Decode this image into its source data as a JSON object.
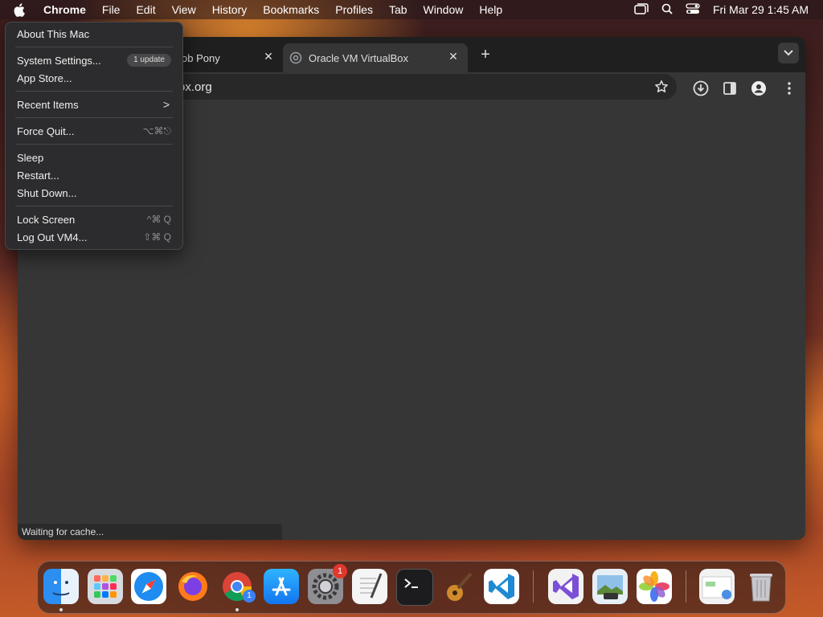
{
  "menubar": {
    "items": [
      "Chrome",
      "File",
      "Edit",
      "View",
      "History",
      "Bookmarks",
      "Profiles",
      "Tab",
      "Window",
      "Help"
    ],
    "clock": "Fri Mar 29  1:45 AM",
    "icons": [
      "apple-icon",
      "window-icon",
      "search-icon",
      "control-center-icon"
    ]
  },
  "apple_menu": {
    "items": [
      {
        "label": "About This Mac"
      },
      {
        "label": "System Settings...",
        "badge": "1 update"
      },
      {
        "label": "App Store..."
      },
      {
        "label": "Recent Items",
        "submenu": ">"
      },
      {
        "label": "Force Quit...",
        "shortcut": "⌥⌘⎋"
      },
      {
        "label": "Sleep"
      },
      {
        "label": "Restart..."
      },
      {
        "label": "Shut Down..."
      },
      {
        "label": "Lock Screen",
        "shortcut": "^⌘ Q"
      },
      {
        "label": "Log Out VM4...",
        "shortcut": "⇧⌘ Q"
      }
    ]
  },
  "browser": {
    "tabs": [
      {
        "title": "Bob Pony",
        "visible_text": "ob Pony"
      },
      {
        "title": "Oracle VM VirtualBox",
        "active": true
      }
    ],
    "tab_close": "✕",
    "new_tab": "+",
    "address_visible": "ox.org",
    "status": "Waiting for cache..."
  },
  "dock": {
    "apps": [
      "Finder",
      "Launchpad",
      "Safari",
      "Firefox",
      "Chrome",
      "App Store",
      "System Settings",
      "TextEdit",
      "Terminal",
      "GarageBand",
      "Visual Studio Code",
      "Visual Studio",
      "Preview",
      "Photos",
      "Finder Window",
      "Trash"
    ],
    "settings_badge": "1",
    "chrome_badge": "1"
  }
}
